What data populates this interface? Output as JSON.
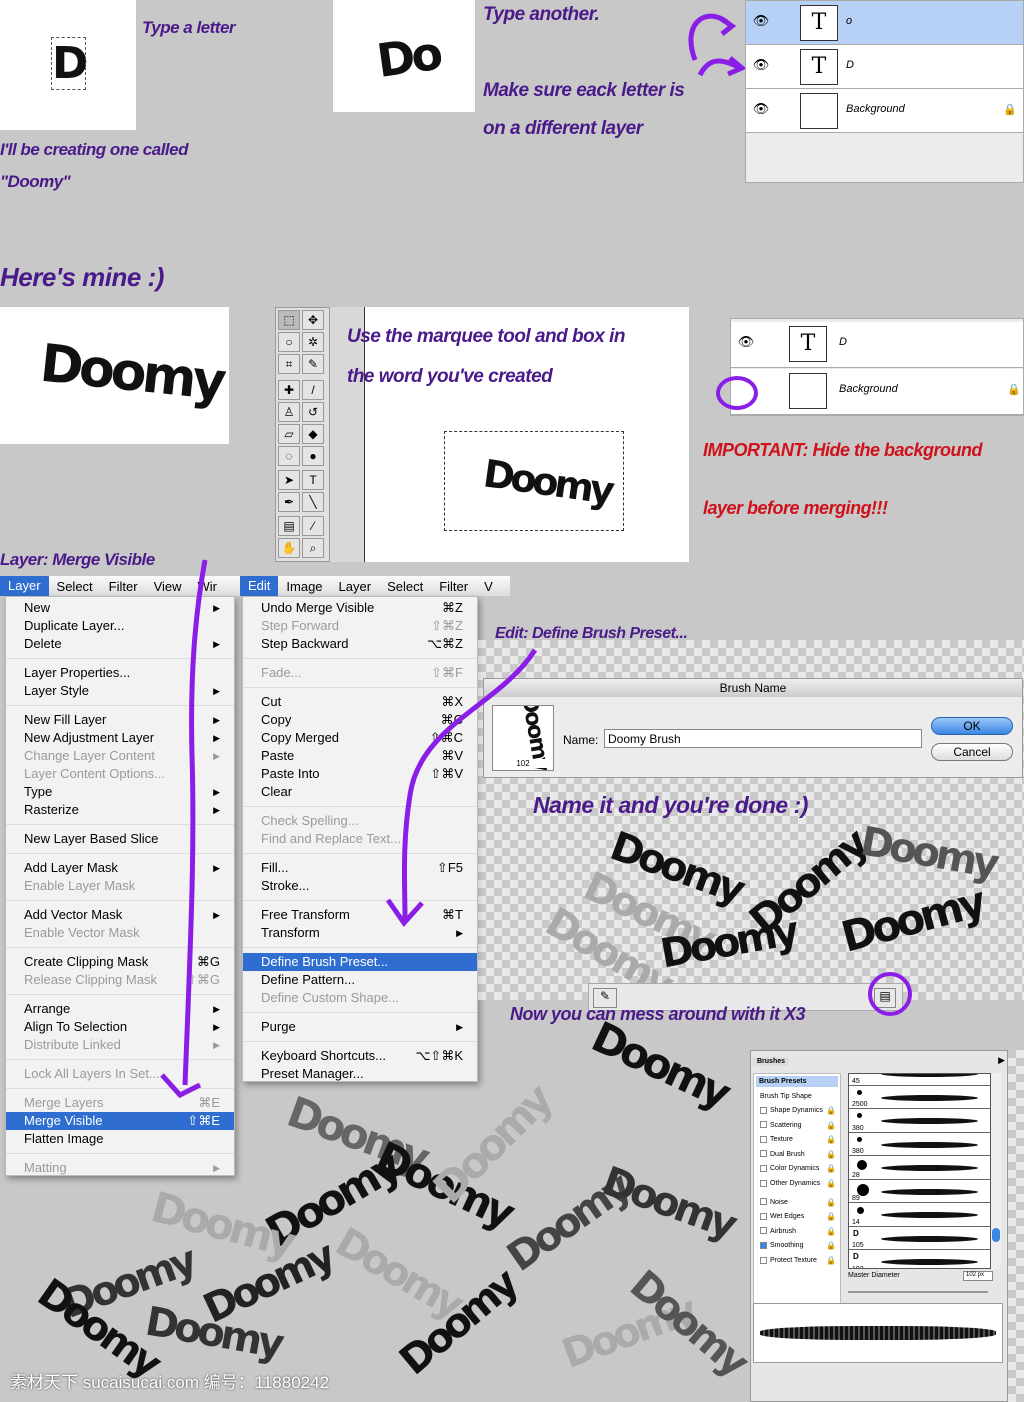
{
  "captions": {
    "type_letter": "Type a letter",
    "creating": "I'll be creating one called",
    "creating2": "\"Doomy\"",
    "type_another": "Type another.",
    "each_layer1": "Make sure eack letter is",
    "each_layer2": "on a different layer",
    "heres_mine": "Here's mine :)",
    "marquee1": "Use the marquee tool and box in",
    "marquee2": "the word you've created",
    "important1": "IMPORTANT: Hide the background",
    "important2": "layer before merging!!!",
    "merge_visible": "Layer: Merge Visible",
    "define_brush": "Edit: Define Brush Preset...",
    "done": "Name it and you're done :)",
    "mess": "Now you can mess around with it X3"
  },
  "samples": {
    "d": "D",
    "do": "Do",
    "doomy": "Doomy"
  },
  "layers_panel_1": [
    {
      "icon": "T",
      "name": "o",
      "selected": true
    },
    {
      "icon": "T",
      "name": "D",
      "selected": false
    },
    {
      "icon": "",
      "name": "Background",
      "locked": true
    }
  ],
  "layers_panel_2": [
    {
      "icon": "T",
      "name": "D",
      "visible": true
    },
    {
      "icon": "",
      "name": "Background",
      "visible": false,
      "locked": true
    }
  ],
  "layer_menubar": [
    "Layer",
    "Select",
    "Filter",
    "View",
    "Wir"
  ],
  "layer_menu": [
    {
      "label": "New",
      "sub": true
    },
    {
      "label": "Duplicate Layer..."
    },
    {
      "label": "Delete",
      "sub": true
    },
    {
      "sep": true
    },
    {
      "label": "Layer Properties..."
    },
    {
      "label": "Layer Style",
      "sub": true
    },
    {
      "sep": true
    },
    {
      "label": "New Fill Layer",
      "sub": true
    },
    {
      "label": "New Adjustment Layer",
      "sub": true
    },
    {
      "label": "Change Layer Content",
      "sub": true,
      "disabled": true
    },
    {
      "label": "Layer Content Options...",
      "disabled": true
    },
    {
      "label": "Type",
      "sub": true
    },
    {
      "label": "Rasterize",
      "sub": true
    },
    {
      "sep": true
    },
    {
      "label": "New Layer Based Slice"
    },
    {
      "sep": true
    },
    {
      "label": "Add Layer Mask",
      "sub": true
    },
    {
      "label": "Enable Layer Mask",
      "disabled": true
    },
    {
      "sep": true
    },
    {
      "label": "Add Vector Mask",
      "sub": true
    },
    {
      "label": "Enable Vector Mask",
      "disabled": true
    },
    {
      "sep": true
    },
    {
      "label": "Create Clipping Mask",
      "shortcut": "⌘G"
    },
    {
      "label": "Release Clipping Mask",
      "shortcut": "⇧⌘G",
      "disabled": true
    },
    {
      "sep": true
    },
    {
      "label": "Arrange",
      "sub": true
    },
    {
      "label": "Align To Selection",
      "sub": true
    },
    {
      "label": "Distribute Linked",
      "sub": true,
      "disabled": true
    },
    {
      "sep": true
    },
    {
      "label": "Lock All Layers In Set...",
      "disabled": true
    },
    {
      "sep": true
    },
    {
      "label": "Merge Layers",
      "shortcut": "⌘E",
      "disabled": true
    },
    {
      "label": "Merge Visible",
      "shortcut": "⇧⌘E",
      "highlighted": true
    },
    {
      "label": "Flatten Image"
    },
    {
      "sep": true
    },
    {
      "label": "Matting",
      "sub": true,
      "disabled": true
    }
  ],
  "edit_menubar": [
    "Edit",
    "Image",
    "Layer",
    "Select",
    "Filter",
    "V"
  ],
  "edit_menu": [
    {
      "label": "Undo Merge Visible",
      "shortcut": "⌘Z"
    },
    {
      "label": "Step Forward",
      "shortcut": "⇧⌘Z",
      "disabled": true
    },
    {
      "label": "Step Backward",
      "shortcut": "⌥⌘Z"
    },
    {
      "sep": true
    },
    {
      "label": "Fade...",
      "shortcut": "⇧⌘F",
      "disabled": true
    },
    {
      "sep": true
    },
    {
      "label": "Cut",
      "shortcut": "⌘X"
    },
    {
      "label": "Copy",
      "shortcut": "⌘C"
    },
    {
      "label": "Copy Merged",
      "shortcut": "⇧⌘C"
    },
    {
      "label": "Paste",
      "shortcut": "⌘V"
    },
    {
      "label": "Paste Into",
      "shortcut": "⇧⌘V"
    },
    {
      "label": "Clear"
    },
    {
      "sep": true
    },
    {
      "label": "Check Spelling...",
      "disabled": true
    },
    {
      "label": "Find and Replace Text...",
      "disabled": true
    },
    {
      "sep": true
    },
    {
      "label": "Fill...",
      "shortcut": "⇧F5"
    },
    {
      "label": "Stroke..."
    },
    {
      "sep": true
    },
    {
      "label": "Free Transform",
      "shortcut": "⌘T"
    },
    {
      "label": "Transform",
      "sub": true
    },
    {
      "sep": true
    },
    {
      "label": "Define Brush Preset...",
      "highlighted": true
    },
    {
      "label": "Define Pattern..."
    },
    {
      "label": "Define Custom Shape...",
      "disabled": true
    },
    {
      "sep": true
    },
    {
      "label": "Purge",
      "sub": true
    },
    {
      "sep": true
    },
    {
      "label": "Keyboard Shortcuts...",
      "shortcut": "⌥⇧⌘K"
    },
    {
      "label": "Preset Manager..."
    }
  ],
  "brush_dialog": {
    "title": "Brush Name",
    "name_label": "Name:",
    "name_value": "Doomy Brush",
    "size": "102",
    "ok": "OK",
    "cancel": "Cancel"
  },
  "brushes_panel": {
    "tab": "Brushes",
    "presets": "Brush Presets",
    "tip_shape": "Brush Tip Shape",
    "options": [
      {
        "label": "Shape Dynamics",
        "checked": false
      },
      {
        "label": "Scattering",
        "checked": false
      },
      {
        "label": "Texture",
        "checked": false
      },
      {
        "label": "Dual Brush",
        "checked": false
      },
      {
        "label": "Color Dynamics",
        "checked": false
      },
      {
        "label": "Other Dynamics",
        "checked": false
      },
      {
        "label": "Noise",
        "checked": false
      },
      {
        "label": "Wet Edges",
        "checked": false
      },
      {
        "label": "Airbrush",
        "checked": false
      },
      {
        "label": "Smoothing",
        "checked": true
      },
      {
        "label": "Protect Texture",
        "checked": false
      }
    ],
    "brush_sizes": [
      "45",
      "2500",
      "380",
      "380",
      "28",
      "89",
      "14",
      "105",
      "102"
    ],
    "master_diameter_label": "Master Diameter",
    "master_diameter": "102 px"
  },
  "watermark": "素材天下 sucaisucai.com  编号：11880242",
  "colors": {
    "caption": "#4a1a8a",
    "important": "#d0101a",
    "highlight": "#2f6ed0",
    "arrow": "#8a1ee6"
  }
}
